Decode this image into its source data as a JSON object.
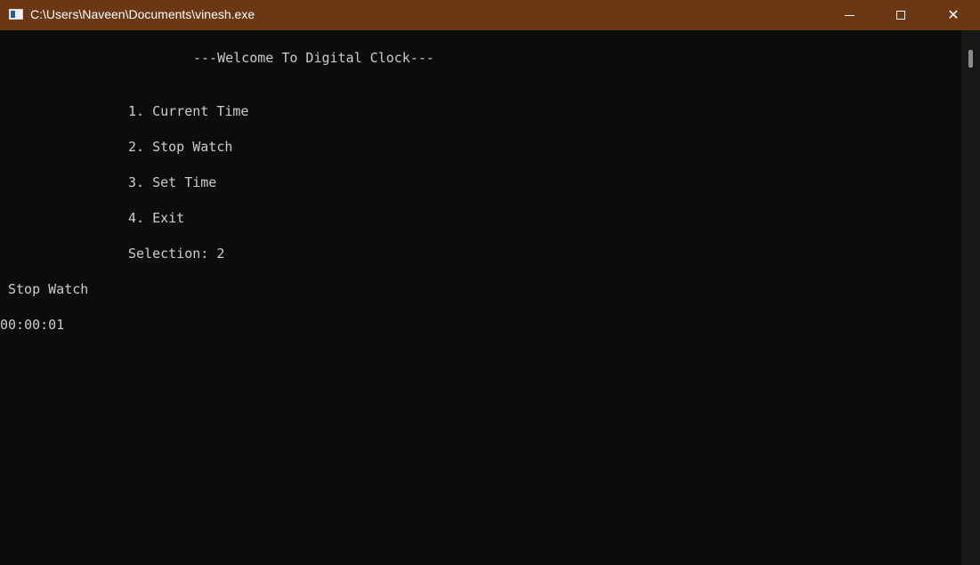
{
  "window": {
    "title": "C:\\Users\\Naveen\\Documents\\vinesh.exe",
    "icon": "console-app-icon",
    "controls": {
      "minimize": "minimize-icon",
      "maximize": "maximize-icon",
      "close_symbol": "✕"
    }
  },
  "console": {
    "header": "---Welcome To Digital Clock---",
    "menu": [
      "1. Current Time",
      "2. Stop Watch",
      "3. Set Time",
      "4. Exit"
    ],
    "selection": "Selection: 2",
    "mode_label": "Stop Watch",
    "timer": "00:00:01"
  },
  "colors": {
    "titlebar": "#6b3715",
    "background": "#0c0c0c",
    "text": "#cccccc"
  }
}
